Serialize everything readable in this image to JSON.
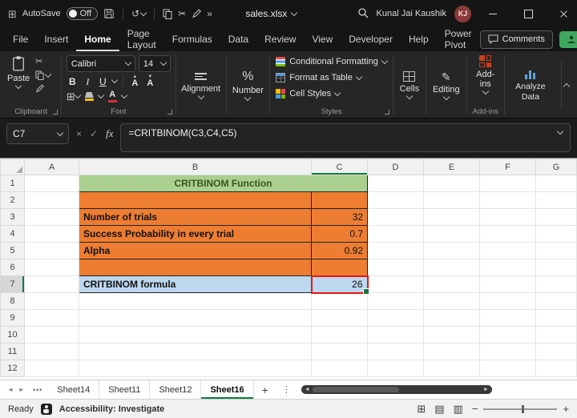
{
  "colors": {
    "excel_green": "#107C41",
    "title_fill_green": "#A9D08E",
    "row_fill_orange": "#ED7D31",
    "result_fill_blue": "#BDD7EE",
    "annotation_red": "#E21717",
    "avatar_maroon": "#8B3A3A"
  },
  "titlebar": {
    "autosave_label": "AutoSave",
    "autosave_state": "Off",
    "filename": "sales.xlsx",
    "user_name": "Kunal Jai Kaushik",
    "user_initials": "KJ"
  },
  "menubar": {
    "items": [
      "File",
      "Insert",
      "Home",
      "Page Layout",
      "Formulas",
      "Data",
      "Review",
      "View",
      "Developer",
      "Help",
      "Power Pivot"
    ],
    "active_item": "Home",
    "comments_label": "Comments"
  },
  "ribbon": {
    "paste_label": "Paste",
    "clipboard_group_label": "Clipboard",
    "font_name": "Calibri",
    "font_size": "14",
    "bold_glyph": "B",
    "italic_glyph": "I",
    "underline_glyph": "U",
    "grow_font_glyph": "A",
    "shrink_font_glyph": "A",
    "font_color_glyph": "A",
    "percent_glyph": "%",
    "font_group_label": "Font",
    "alignment_label": "Alignment",
    "number_label": "Number",
    "conditional_formatting_label": "Conditional Formatting",
    "format_as_table_label": "Format as Table",
    "cell_styles_label": "Cell Styles",
    "styles_group_label": "Styles",
    "cells_label": "Cells",
    "editing_label": "Editing",
    "addins_label": "Add-ins",
    "addins_group_label": "Add-ins",
    "analyze_data_label": "Analyze Data"
  },
  "formula_bar": {
    "name_box_value": "C7",
    "fx_label": "fx",
    "formula": "=CRITBINOM(C3,C4,C5)"
  },
  "sheet": {
    "columns": [
      "A",
      "B",
      "C",
      "D",
      "E",
      "F",
      "G"
    ],
    "row_numbers": [
      "1",
      "2",
      "3",
      "4",
      "5",
      "6",
      "7",
      "8",
      "9",
      "10",
      "11",
      "12"
    ],
    "title": "CRITBINOM Function",
    "b3": "Number of trials",
    "c3": "32",
    "b4": "Success Probability in every trial",
    "c4": "0.7",
    "b5": "Alpha",
    "c5": "0.92",
    "b7": "CRITBINOM formula",
    "c7": "26",
    "selected_cell": "C7"
  },
  "tabs": {
    "overflow_glyph": "•••",
    "items": [
      "Sheet14",
      "Sheet11",
      "Sheet12",
      "Sheet16"
    ],
    "active_tab": "Sheet16",
    "add_glyph": "+"
  },
  "statusbar": {
    "ready_label": "Ready",
    "accessibility_label": "Accessibility: Investigate"
  }
}
